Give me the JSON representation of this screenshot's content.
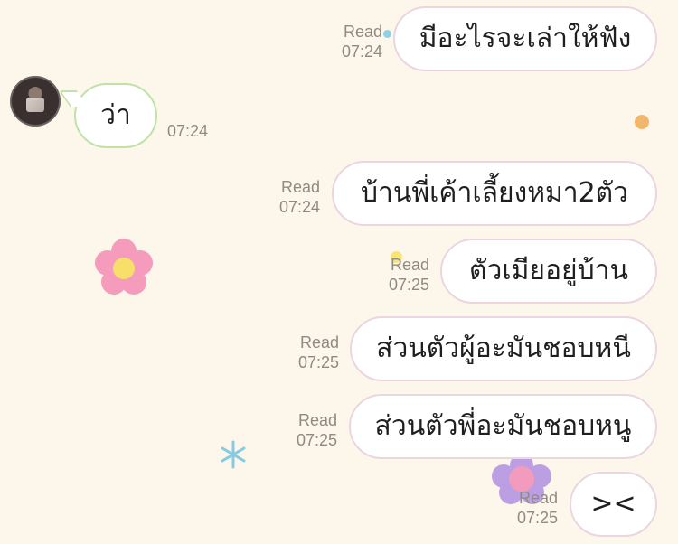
{
  "colors": {
    "background": "#fdf6ea",
    "outgoing_border": "#ead6e0",
    "incoming_border": "#bfe3a7",
    "meta_text": "#8f8a83"
  },
  "messages": {
    "m1": {
      "text": "มีอะไรจะเล่าให้ฟัง",
      "read": "Read",
      "time": "07:24"
    },
    "m2": {
      "text": "ว่า",
      "time": "07:24"
    },
    "m3": {
      "text": "บ้านพี่เค้าเลี้ยงหมา2ตัว",
      "read": "Read",
      "time": "07:24"
    },
    "m4": {
      "text": "ตัวเมียอยู่บ้าน",
      "read": "Read",
      "time": "07:25"
    },
    "m5": {
      "text": "ส่วนตัวผู้อะมันชอบหนี",
      "read": "Read",
      "time": "07:25"
    },
    "m6": {
      "text": "ส่วนตัวพี่อะมันชอบหนู",
      "read": "Read",
      "time": "07:25"
    },
    "m7": {
      "text": "><",
      "read": "Read",
      "time": "07:25"
    }
  },
  "icons": {
    "avatar": "avatar",
    "pink_flower": "flower-sticker-icon",
    "purple_flower": "flower-sticker-icon",
    "sparkle": "sparkle-icon"
  }
}
